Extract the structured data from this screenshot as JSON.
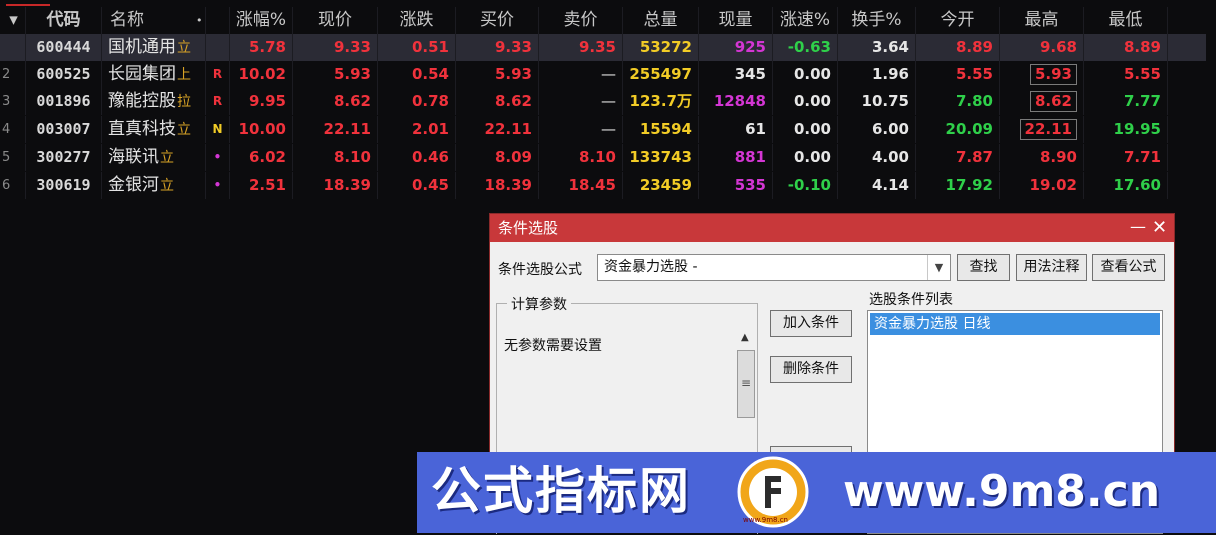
{
  "table": {
    "headers": {
      "idx": "▾",
      "code": "代码",
      "name": "名称",
      "name_dot": "•",
      "zf": "涨幅%",
      "xj": "现价",
      "zd": "涨跌",
      "mr": "买价",
      "mc": "卖价",
      "zl": "总量",
      "xl": "现量",
      "zs": "涨速%",
      "hs": "换手%",
      "jk": "今开",
      "zg": "最高",
      "zdi": "最低"
    },
    "rows": [
      {
        "idx": "",
        "code": "600444",
        "name": "国机通用",
        "tag": "立",
        "flag": "",
        "zf": "5.78",
        "xj": "9.33",
        "zd": "0.51",
        "mr": "9.33",
        "mc": "9.35",
        "zl": "53272",
        "xl": "925",
        "zs": "-0.63",
        "hs": "3.64",
        "jk": "8.89",
        "zg": "9.68",
        "zdi": "8.89"
      },
      {
        "idx": "2",
        "code": "600525",
        "name": "长园集团",
        "tag": "上",
        "flag": "R",
        "zf": "10.02",
        "xj": "5.93",
        "zd": "0.54",
        "mr": "5.93",
        "mc": "—",
        "zl": "255497",
        "xl": "345",
        "zs": "0.00",
        "hs": "1.96",
        "jk": "5.55",
        "zg": "5.93",
        "zdi": "5.55"
      },
      {
        "idx": "3",
        "code": "001896",
        "name": "豫能控股",
        "tag": "拉",
        "flag": "R",
        "zf": "9.95",
        "xj": "8.62",
        "zd": "0.78",
        "mr": "8.62",
        "mc": "—",
        "zl": "123.7万",
        "xl": "12848",
        "zs": "0.00",
        "hs": "10.75",
        "jk": "7.80",
        "zg": "8.62",
        "zdi": "7.77"
      },
      {
        "idx": "4",
        "code": "003007",
        "name": "直真科技",
        "tag": "立",
        "flag": "N",
        "zf": "10.00",
        "xj": "22.11",
        "zd": "2.01",
        "mr": "22.11",
        "mc": "—",
        "zl": "15594",
        "xl": "61",
        "zs": "0.00",
        "hs": "6.00",
        "jk": "20.09",
        "zg": "22.11",
        "zdi": "19.95"
      },
      {
        "idx": "5",
        "code": "300277",
        "name": "海联讯",
        "tag": "立",
        "flag": "•",
        "zf": "6.02",
        "xj": "8.10",
        "zd": "0.46",
        "mr": "8.09",
        "mc": "8.10",
        "zl": "133743",
        "xl": "881",
        "zs": "0.00",
        "hs": "4.00",
        "jk": "7.87",
        "zg": "8.90",
        "zdi": "7.71"
      },
      {
        "idx": "6",
        "code": "300619",
        "name": "金银河",
        "tag": "立",
        "flag": "•",
        "zf": "2.51",
        "xj": "18.39",
        "zd": "0.45",
        "mr": "18.39",
        "mc": "18.45",
        "zl": "23459",
        "xl": "535",
        "zs": "-0.10",
        "hs": "4.14",
        "jk": "17.92",
        "zg": "19.02",
        "zdi": "17.60"
      }
    ]
  },
  "dialog": {
    "title": "条件选股",
    "minimize": "—",
    "close": "✕",
    "formula_label": "条件选股公式",
    "formula_value": "资金暴力选股 -",
    "find_btn": "查找",
    "usage_btn": "用法注释",
    "view_btn": "查看公式",
    "params_legend": "计算参数",
    "params_msg": "无参数需要设置",
    "add_btn": "加入条件",
    "delete_btn": "删除条件",
    "list_label": "选股条件列表",
    "list_items": [
      "资金暴力选股  日线"
    ]
  },
  "banner": {
    "title": "公式指标网",
    "url": "www.9m8.cn",
    "logo_text": "www.9m8.cn"
  },
  "colors": {
    "up": "#f0323c",
    "down": "#2fd04a",
    "volume": "#f2cc26",
    "current_volume": "#d436d4",
    "dialog_title": "#c8383a",
    "banner": "#4a64d8"
  }
}
